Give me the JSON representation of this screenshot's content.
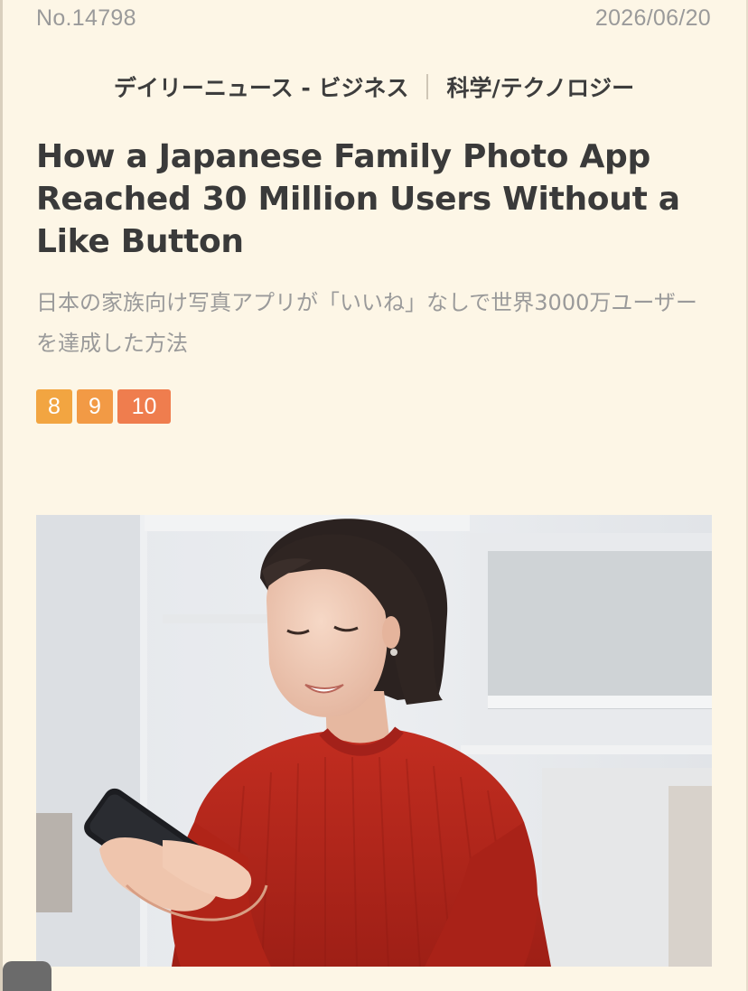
{
  "article": {
    "number": "No.14798",
    "date": "2026/06/20",
    "categories": [
      "デイリーニュース - ビジネス",
      "科学/テクノロジー"
    ],
    "title": "How a Japanese Family Photo App Reached 30 Million Users Without a Like Button",
    "subtitle": "日本の家族向け写真アプリが「いいね」なしで世界3000万ユーザーを達成した方法",
    "levels": [
      "8",
      "9",
      "10"
    ]
  },
  "colors": {
    "background": "#fdf6e6",
    "level_8": "#f2a541",
    "level_9": "#f29a45",
    "level_10": "#ef7d4e",
    "sweater": "#b5261c"
  }
}
